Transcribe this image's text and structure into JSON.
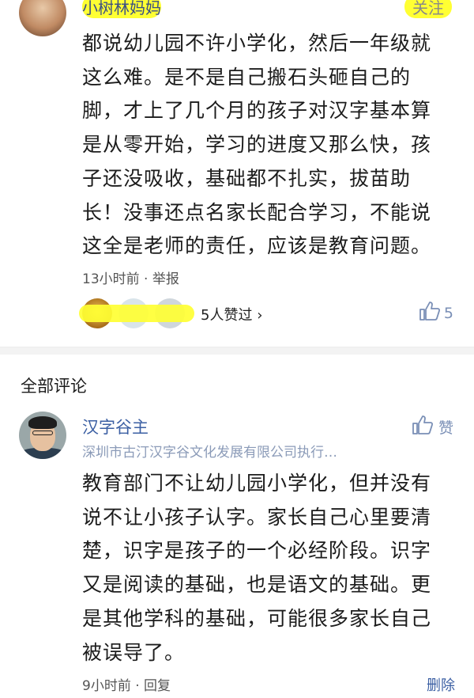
{
  "top_post": {
    "username": "小树林妈妈",
    "follow_label": "关注",
    "text": "都说幼儿园不许小学化，然后一年级就这么难。是不是自己搬石头砸自己的脚，才上了几个月的孩子对汉字基本算是从零开始，学习的进度又那么快，孩子还没吸收，基础都不扎实，拔苗助长！没事还点名家长配合学习，不能说这全是老师的责任，应该是教育问题。",
    "time": "13小时前",
    "report_label": "举报",
    "likers_summary": "5人赞过",
    "like_count": "5",
    "colors": {
      "accent": "#3b5fa3",
      "highlight": "#ffff33"
    }
  },
  "section": {
    "title": "全部评论"
  },
  "comment": {
    "name": "汉字谷主",
    "org": "深圳市古汀汉字谷文化发展有限公司执行…",
    "like_label": "赞",
    "text": "教育部门不让幼儿园小学化，但并没有说不让小孩子认字。家长自己心里要清楚，识字是孩子的一个必经阶段。识字又是阅读的基础，也是语文的基础。更是其他学科的基础，可能很多家长自己被误导了。",
    "time": "9小时前",
    "reply_label": "回复",
    "delete_label": "删除"
  },
  "icons": {
    "like": "thumbs-up-icon",
    "chevron": "chevron-right-icon"
  }
}
